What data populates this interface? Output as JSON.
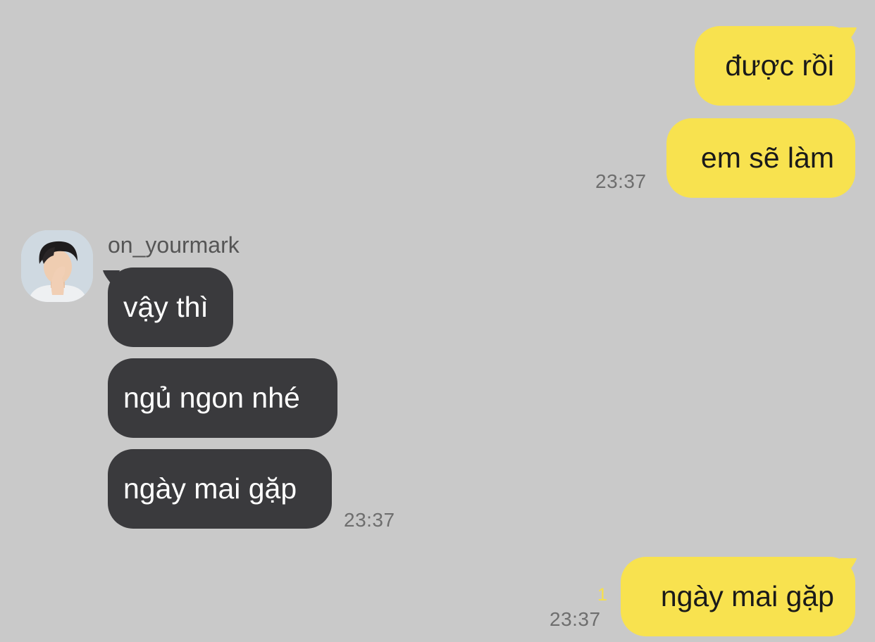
{
  "conversation": {
    "messages": [
      {
        "direction": "outgoing",
        "text": "được rồi"
      },
      {
        "direction": "outgoing",
        "text": "em sẽ làm",
        "time": "23:37"
      },
      {
        "direction": "incoming",
        "sender": "on_yourmark",
        "text": "vậy thì"
      },
      {
        "direction": "incoming",
        "text": "ngủ ngon nhé"
      },
      {
        "direction": "incoming",
        "text": "ngày mai gặp",
        "time": "23:37"
      },
      {
        "direction": "outgoing",
        "text": "ngày mai gặp",
        "time": "23:37",
        "unread_count": "1"
      }
    ]
  },
  "colors": {
    "background": "#c9c9c9",
    "outgoing_bubble": "#f8e24f",
    "incoming_bubble": "#3a3a3d",
    "unread_indicator": "#f7e04b"
  }
}
